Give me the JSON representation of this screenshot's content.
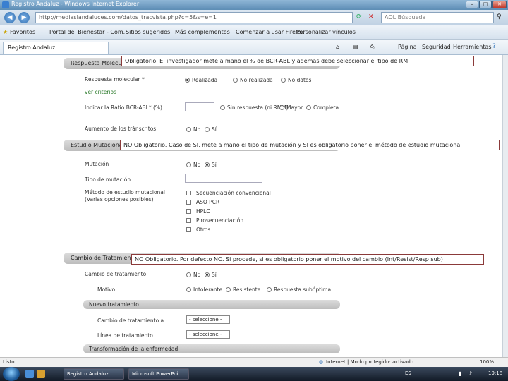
{
  "window": {
    "title": "Registro Andaluz - Windows Internet Explorer",
    "url": "http://mediaslandaluces.com/datos_tracvista.php?c=5&s=e=1",
    "search_placeholder": "AOL Búsqueda"
  },
  "favorites_bar": {
    "favorites_label": "Favoritos",
    "items": [
      "Portal del Bienestar - Com...",
      "Sitios sugeridos",
      "Más complementos",
      "Comenzar a usar Firefox",
      "Personalizar vínculos"
    ]
  },
  "tab": {
    "label": "Registro Andaluz"
  },
  "command_bar": {
    "page": "Página",
    "safety": "Seguridad",
    "tools": "Herramientas"
  },
  "sections": {
    "respuesta": {
      "heading": "Respuesta Molecular",
      "question": "Respuesta molecular *",
      "options": [
        "Realizada",
        "No realizada",
        "No datos"
      ],
      "criteria_label": "ver criterios",
      "ratio_label": "Indicar la Ratio BCR-ABL* (%)",
      "ratio_value": "",
      "ratio_options": [
        "Sin respuesta (ni RMM)",
        "Mayor",
        "Completa"
      ],
      "transcripts_label": "Aumento de los tránscritos",
      "transcripts_options": [
        "No",
        "Sí"
      ]
    },
    "estudio": {
      "heading": "Estudio Mutacional",
      "mutation_label": "Mutación",
      "mutation_options": [
        "No",
        "Sí"
      ],
      "mutation_type_label": "Tipo de mutación",
      "mutation_type_value": "",
      "method_label": "Método de estudio mutacional",
      "method_hint": "(Varias opciones posibles)",
      "methods": [
        "Secuenciación convencional",
        "ASO PCR",
        "HPLC",
        "Pirosecuenciación",
        "Otros"
      ]
    },
    "cambio": {
      "heading": "Cambio de Tratamiento",
      "change_label": "Cambio de tratamiento",
      "change_options": [
        "No",
        "Sí"
      ],
      "motive_label": "Motivo",
      "motive_options": [
        "Intolerante",
        "Resistente",
        "Respuesta subóptima"
      ],
      "new_treatment_heading": "Nuevo tratamiento",
      "change_to_label": "Cambio de tratamiento a",
      "change_to_value": "- seleccione -",
      "line_label": "Línea de tratamiento",
      "line_value": "- seleccione -",
      "transformation_heading": "Transformación de la enfermedad"
    }
  },
  "annotations": {
    "a1": "Obligatorio. El investigador mete a mano el % de BCR-ABL y además debe seleccionar el tipo de RM",
    "a2": "NO Obligatorio. Caso de SI, mete a mano el tipo de mutación y SI es obligatorio poner el método de estudio mutacional",
    "a3": "NO Obligatorio. Por defecto NO. Si procede, si es obligatorio poner el motivo del cambio (Int/Resist/Resp sub)"
  },
  "statusbar": {
    "left": "Listo",
    "zone": "Internet | Modo protegido: activado",
    "zoom": "100%"
  },
  "taskbar": {
    "task1": "Registro Andaluz ...",
    "task2": "Microsoft PowerPoi...",
    "lang": "ES",
    "clock": "19:18"
  },
  "colors": {
    "annotation_border": "#8b3a3a",
    "section_header": "#c8c8c8"
  }
}
